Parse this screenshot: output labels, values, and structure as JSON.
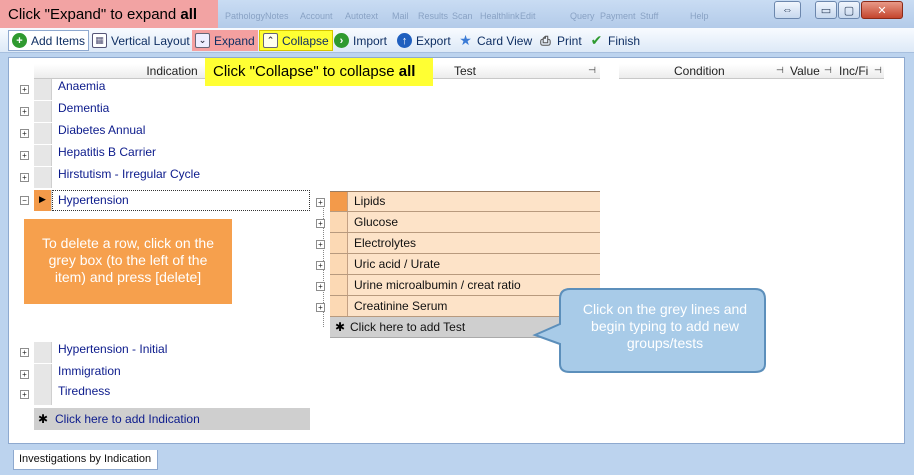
{
  "titlebar": {
    "faint_tabs": [
      "Pathology",
      "Notes",
      "Account",
      "Autotext",
      "Mail",
      "Results",
      "Scan",
      "Healthlink",
      "Edit",
      "Query",
      "Payment",
      "Stuff",
      "Help"
    ],
    "callout_expand": {
      "prefix": "Click \"Expand\" to expand ",
      "bold": "all"
    },
    "restore_icon": "⇔",
    "minimize_icon": "▭",
    "maximize_icon": "▢",
    "close_icon": "✕"
  },
  "toolbar": {
    "add_items": "Add Items",
    "vertical_layout": "Vertical Layout",
    "expand": "Expand",
    "collapse": "Collapse",
    "import": "Import",
    "export": "Export",
    "card_view": "Card View",
    "print": "Print",
    "finish": "Finish"
  },
  "columns": {
    "indication": "Indication",
    "test": "Test",
    "condition": "Condition",
    "value": "Value",
    "incfi": "Inc/Fi"
  },
  "callout_collapse": {
    "prefix": "Click \"Collapse\" to collapse ",
    "bold": "all"
  },
  "indications_before": [
    "Anaemia",
    "Dementia",
    "Diabetes Annual",
    "Hepatitis B Carrier",
    "Hirstutism - Irregular Cycle"
  ],
  "selected_indication": "Hypertension",
  "tests": [
    "Lipids",
    "Glucose",
    "Electrolytes",
    "Uric acid / Urate",
    "Urine microalbumin / creat ratio",
    "Creatinine Serum"
  ],
  "add_test": "Click here to add Test",
  "indications_after": [
    "Hypertension - Initial",
    "Immigration",
    "Tiredness"
  ],
  "add_indication": "Click here to add Indication",
  "delete_note": "To delete a row, click on the grey box (to the left of the item) and press [delete]",
  "grey_lines_note": "Click on the grey lines and begin typing to add new groups/tests",
  "bottom_tab": "Investigations by Indication",
  "colors": {
    "orange_note": "#f6a04d",
    "yellow_note": "#ffff33",
    "pink_note": "#f4a0a0",
    "bubble": "#a8cbe8",
    "test_row": "#fde3c8"
  }
}
